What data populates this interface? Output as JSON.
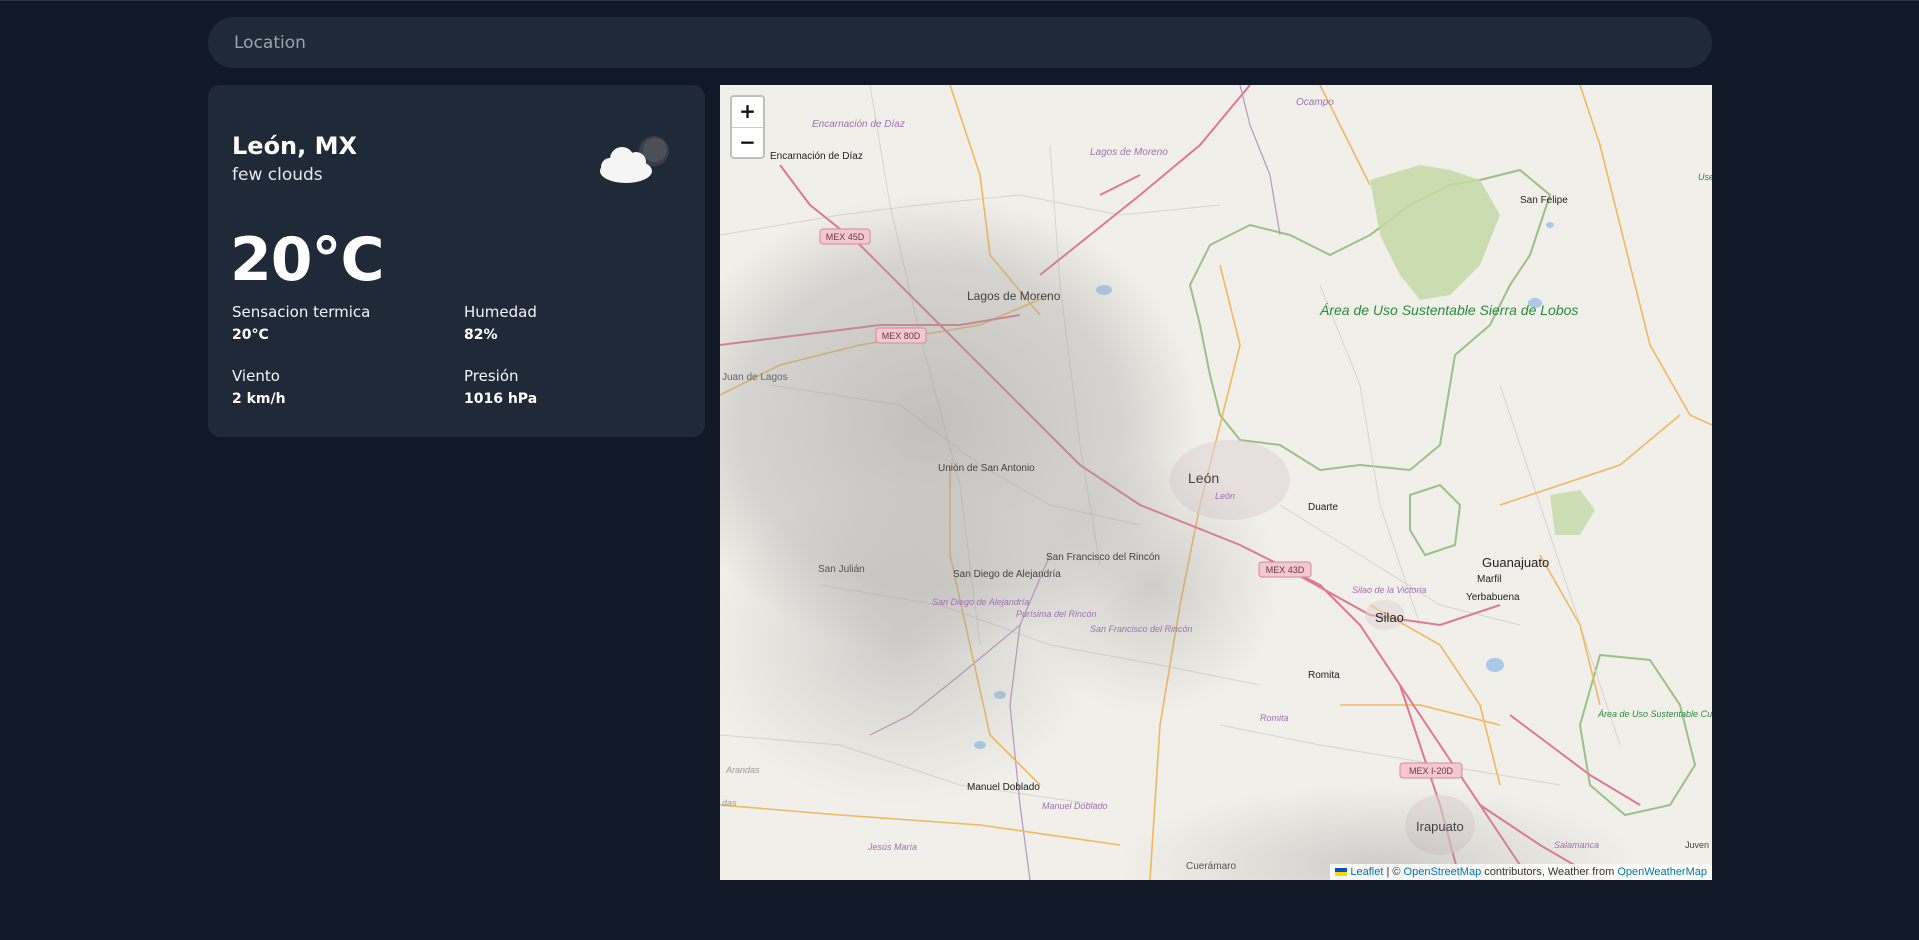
{
  "search": {
    "placeholder": "Location"
  },
  "weather": {
    "city": "León, MX",
    "description": "few clouds",
    "icon": "few-clouds-icon",
    "temperature": "20°C",
    "stats": [
      {
        "label": "Sensacion termica",
        "value": "20°C"
      },
      {
        "label": "Humedad",
        "value": "82%"
      },
      {
        "label": "Viento",
        "value": "2 km/h"
      },
      {
        "label": "Presión",
        "value": "1016 hPa"
      }
    ]
  },
  "map": {
    "zoom_in": "+",
    "zoom_out": "−",
    "places": {
      "encarnacion": "Encarnación de Díaz",
      "encarnacion_mun": "Encarnación de Díaz",
      "lagos": "Lagos de Moreno",
      "lagos_mun": "Lagos de Moreno",
      "ocampo": "Ocampo",
      "san_felipe": "San Felipe",
      "sierra": "Área de Uso Sustentable Sierra de Lobos",
      "juan": "Juan de Lagos",
      "union": "Unión de San Antonio",
      "leon": "León",
      "leon_mun": "León",
      "duarte": "Duarte",
      "guanajuato": "Guanajuato",
      "marfil": "Marfil",
      "yerbabuena": "Yerbabuena",
      "san_julian": "San Julián",
      "sd_alejandria": "San Diego de Alejandría",
      "sd_alejandria_mun": "San Diego de Alejandría",
      "sf_rincon": "San Francisco del Rincón",
      "sf_rincon_mun": "San Francisco del Rincón",
      "purisima": "Purísima del Rincón",
      "silao_mun": "Silao de la Victoria",
      "silao": "Silao",
      "romita": "Romita",
      "romita_mun": "Romita",
      "cuenca": "Área de Uso Sustentable Cuenca Alta del Río Temascatío",
      "manuel": "Manuel Doblado",
      "manuel_mun": "Manuel Doblado",
      "arandas": "Arandas",
      "das": "das",
      "jesus": "Jesús María",
      "cueramaro": "Cuerámaro",
      "irapuato": "Irapuato",
      "salamanca": "Salamanca",
      "juven": "Juven",
      "use": "Use"
    },
    "shields": {
      "mex45d": "MEX 45D",
      "mex80d": "MEX 80D",
      "mex43d": "MEX 43D",
      "mexi20d": "MEX I-20D"
    },
    "attribution": {
      "leaflet": "Leaflet",
      "sep1": " | © ",
      "osm": "OpenStreetMap",
      "middle": " contributors, Weather from ",
      "owm": "OpenWeatherMap"
    }
  },
  "colors": {
    "background": "#111827",
    "card": "#1f2937",
    "map_land": "#f1efe9",
    "protected_area": "#c4d9a6",
    "road_primary": "#e07890",
    "road_secondary": "#f0b860"
  }
}
